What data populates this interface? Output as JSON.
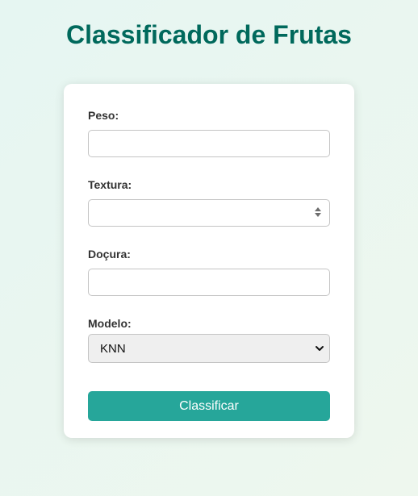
{
  "page": {
    "title": "Classificador de Frutas"
  },
  "form": {
    "peso": {
      "label": "Peso:",
      "value": "",
      "placeholder": ""
    },
    "textura": {
      "label": "Textura:",
      "value": "",
      "placeholder": ""
    },
    "docura": {
      "label": "Doçura:",
      "value": "",
      "placeholder": ""
    },
    "modelo": {
      "label": "Modelo:",
      "selected": "KNN"
    },
    "submit_label": "Classificar"
  },
  "icons": {
    "stepper": "number-stepper-icon",
    "select": "chevron-down-icon"
  },
  "colors": {
    "title": "#00695c",
    "button": "#26a69a",
    "background": "#e6f6f2"
  }
}
